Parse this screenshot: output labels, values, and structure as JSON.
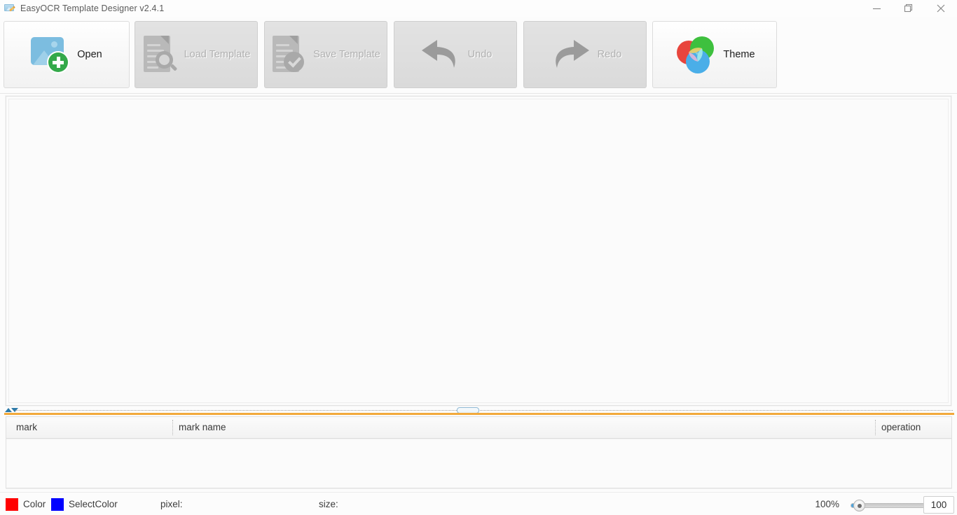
{
  "window": {
    "title": "EasyOCR Template Designer v2.4.1",
    "icon": "image-pencil-icon",
    "controls": {
      "minimize": "minimize-icon",
      "maximize": "maximize-icon",
      "close": "close-icon"
    }
  },
  "toolbar": {
    "buttons": [
      {
        "id": "open",
        "label": "Open",
        "icon": "image-add-icon",
        "enabled": true
      },
      {
        "id": "load-template",
        "label": "Load Template",
        "icon": "document-search-icon",
        "enabled": false
      },
      {
        "id": "save-template",
        "label": "Save Template",
        "icon": "document-check-icon",
        "enabled": false
      },
      {
        "id": "undo",
        "label": "Undo",
        "icon": "undo-arrow-icon",
        "enabled": false
      },
      {
        "id": "redo",
        "label": "Redo",
        "icon": "redo-arrow-icon",
        "enabled": false
      },
      {
        "id": "theme",
        "label": "Theme",
        "icon": "color-circles-icon",
        "enabled": true
      }
    ]
  },
  "canvas": {
    "content": ""
  },
  "splitter": {
    "collapse_up_icon": "triangle-up-icon",
    "collapse_down_icon": "triangle-down-icon",
    "accent_color": "#f2a93b"
  },
  "mark_table": {
    "columns": [
      {
        "id": "mark",
        "label": "mark"
      },
      {
        "id": "mark-name",
        "label": "mark name"
      },
      {
        "id": "operation",
        "label": "operation"
      }
    ],
    "rows": []
  },
  "statusbar": {
    "color_swatch": "#ff0000",
    "color_label": "Color",
    "select_color_swatch": "#0000ff",
    "select_color_label": "SelectColor",
    "pixel_label": "pixel:",
    "pixel_value": "",
    "size_label": "size:",
    "size_value": "",
    "zoom_percent": "100%",
    "zoom_value": "100"
  }
}
